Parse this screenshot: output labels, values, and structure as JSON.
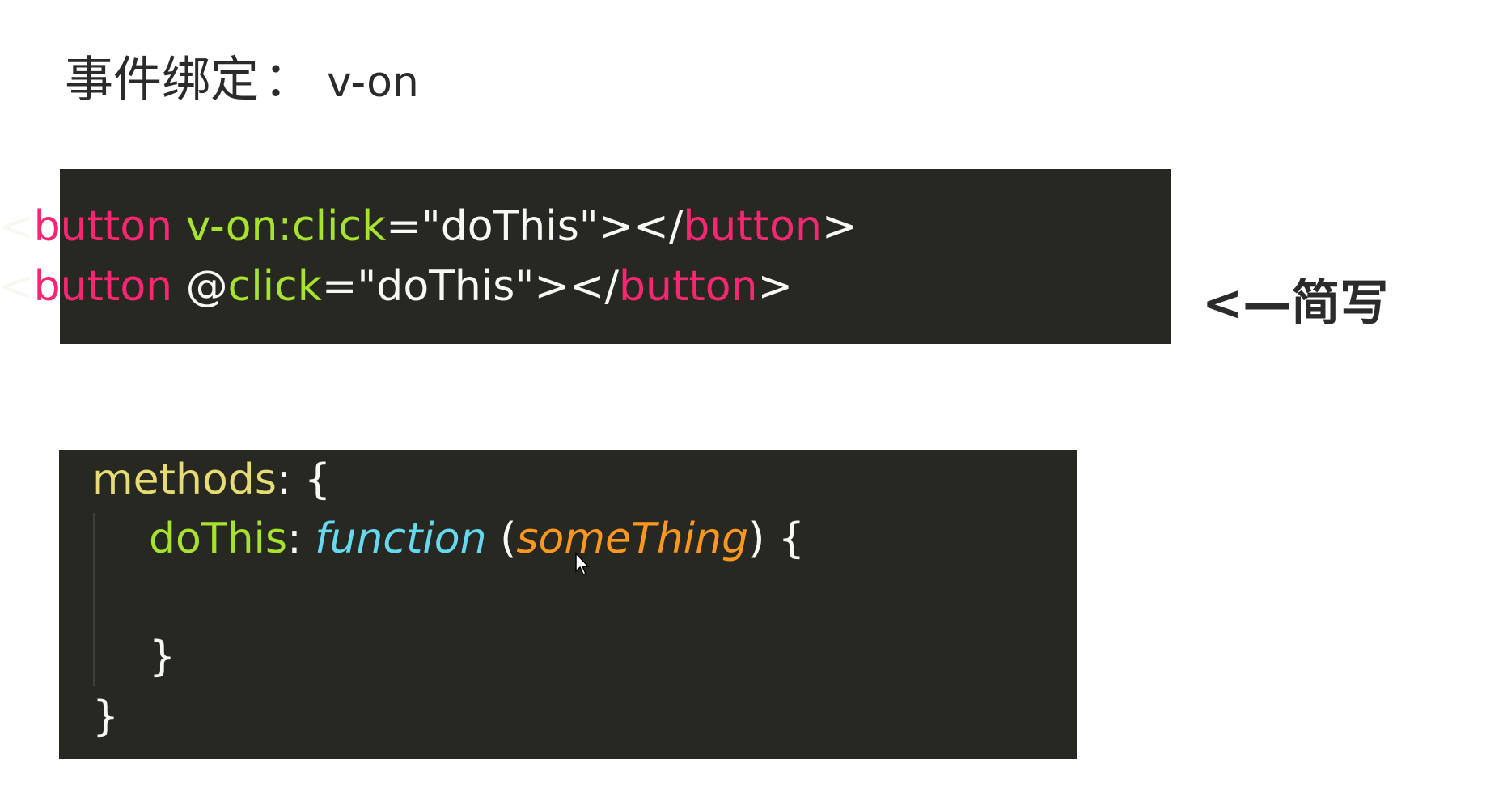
{
  "title": {
    "label": "事件绑定",
    "separator": "：",
    "directive": "v-on"
  },
  "code_block_1": {
    "line1": {
      "open_bracket": "<",
      "tag": "button",
      "space": " ",
      "attr": "v-on:click",
      "eq": "=",
      "value": "\"doThis\"",
      "close": "></",
      "close_tag": "button",
      "end": ">"
    },
    "line2": {
      "open_bracket": "<",
      "tag": "button",
      "space": " ",
      "at": "@",
      "attr": "click",
      "eq": "=",
      "value": "\"doThis\"",
      "close": "></",
      "close_tag": "button",
      "end": ">"
    }
  },
  "code_block_2": {
    "line1": {
      "key": "methods",
      "colon": ":",
      "brace": " {"
    },
    "line2": {
      "key": "doThis",
      "colon": ": ",
      "keyword": "function",
      "open_paren": " (",
      "param": "someThing",
      "close_paren": ")",
      "brace": " {"
    },
    "line3": {
      "brace": "}"
    },
    "line4": {
      "brace": "}"
    }
  },
  "annotation": {
    "arrow": "<—",
    "text": "简写"
  },
  "colors": {
    "code_bg": "#272822",
    "tag": "#f92672",
    "attr": "#a6e22e",
    "keyword": "#66d9ef",
    "param": "#fd971f",
    "prop": "#e6db74"
  }
}
